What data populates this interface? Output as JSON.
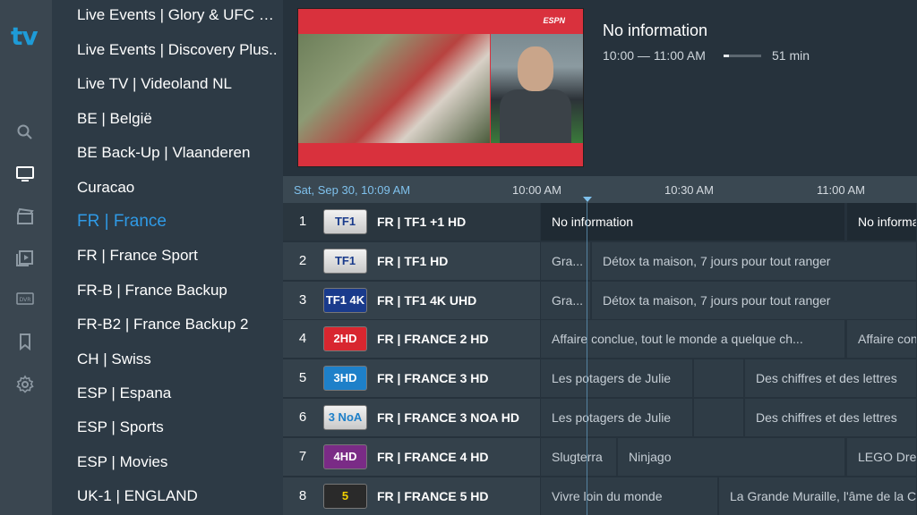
{
  "app": {
    "logo": "tv"
  },
  "nav": [
    {
      "name": "search-icon"
    },
    {
      "name": "tv-icon"
    },
    {
      "name": "movies-icon"
    },
    {
      "name": "series-icon"
    },
    {
      "name": "dvr-icon",
      "label": "DVR"
    },
    {
      "name": "bookmark-icon"
    },
    {
      "name": "settings-icon"
    }
  ],
  "groups": [
    "Live Events | Glory & UFC an..",
    "Live Events | Discovery Plus..",
    "Live TV | Videoland NL",
    "BE | België",
    "BE Back-Up | Vlaanderen",
    "Curacao",
    "FR | France",
    "FR | France Sport",
    "FR-B | France Backup",
    "FR-B2 | France Backup 2",
    "CH | Swiss",
    "ESP | Espana",
    "ESP | Sports",
    "ESP | Movies",
    "UK-1 | ENGLAND"
  ],
  "active_group_index": 6,
  "preview": {
    "badge": "ESPN"
  },
  "now_playing": {
    "title": "No information",
    "time": "10:00 — 11:00 AM",
    "progress": 0.15,
    "duration": "51 min"
  },
  "timeline": {
    "now": "Sat, Sep 30, 10:09 AM",
    "marks": [
      "10:00 AM",
      "10:30 AM",
      "11:00 AM"
    ]
  },
  "channels": [
    {
      "num": "1",
      "logo": "TF1",
      "name": "FR | TF1 +1 HD",
      "programs": [
        "No information",
        "No informa"
      ]
    },
    {
      "num": "2",
      "logo": "TF1",
      "name": "FR | TF1 HD",
      "programs": [
        "Gra...",
        "Détox ta maison, 7 jours pour tout ranger"
      ]
    },
    {
      "num": "3",
      "logo": "TF1 4K",
      "name": "FR | TF1 4K UHD",
      "programs": [
        "Gra...",
        "Détox ta maison, 7 jours pour tout ranger"
      ]
    },
    {
      "num": "4",
      "logo": "2HD",
      "name": "FR | FRANCE 2 HD",
      "programs": [
        "Affaire conclue, tout le monde a quelque ch...",
        "Affaire con"
      ]
    },
    {
      "num": "5",
      "logo": "3HD",
      "name": "FR | FRANCE 3 HD",
      "programs": [
        "Les potagers de Julie",
        "",
        "Des chiffres et des lettres"
      ]
    },
    {
      "num": "6",
      "logo": "3 NoA",
      "name": "FR | FRANCE 3 NOA HD",
      "programs": [
        "Les potagers de Julie",
        "",
        "Des chiffres et des lettres"
      ]
    },
    {
      "num": "7",
      "logo": "4HD",
      "name": "FR | FRANCE 4 HD",
      "programs": [
        "Slugterra",
        "Ninjago",
        "LEGO Drea"
      ]
    },
    {
      "num": "8",
      "logo": "5",
      "name": "FR | FRANCE 5 HD",
      "programs": [
        "Vivre loin du monde",
        "La Grande Muraille, l'âme de la C"
      ]
    }
  ],
  "colors": {
    "accent": "#2f9ae6",
    "logo_tf1": "#1a3b8c",
    "logo_france2": "#d8262f",
    "logo_france3": "#1e80c9",
    "logo_france4": "#7a2b86",
    "logo_france5": "#f0d000"
  }
}
